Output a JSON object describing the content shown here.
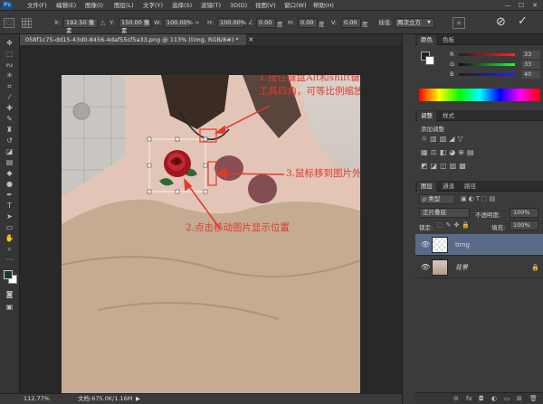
{
  "menubar": {
    "items": [
      "文件(F)",
      "编辑(E)",
      "图像(I)",
      "图层(L)",
      "文字(Y)",
      "选择(S)",
      "滤镜(T)",
      "3D(D)",
      "视图(V)",
      "窗口(W)",
      "帮助(H)"
    ],
    "minimize": "—",
    "restore": "☐",
    "close": "✕"
  },
  "options": {
    "x_label": "X:",
    "x_value": "192.50 像素",
    "y_label": "Y:",
    "y_value": "150.00 像素",
    "w_label": "W:",
    "w_value": "100.00%",
    "h_label": "H:",
    "h_value": "100.00%",
    "angle_value": "0.00",
    "hskew_label": "H:",
    "hskew_value": "0.00",
    "vskew_label": "V:",
    "vskew_value": "0.00",
    "interp_label": "插值:",
    "interp_value": "两次立方",
    "cancel": "⊘",
    "commit": "✓"
  },
  "document": {
    "tab_title": "058f1c75-dd15-43d0-8456-4daf55cf5a33.png @ 113% (timg, RGB/8#) *",
    "tab_close": "×"
  },
  "annotations": {
    "a1_line1": "1.按住键盘Alt和shift键，鼠标移动变形",
    "a1_line2": "工具四角，可等比例缩放图片",
    "a2": "2.点击移动图片显示位置",
    "a3": "3.鼠标移到图片外面可旋转图片"
  },
  "status": {
    "zoom": "112.77%",
    "doc_info": "文档:675.0K/1.16M",
    "arrow": "▶"
  },
  "color_panel": {
    "tabs": [
      "颜色",
      "色板"
    ],
    "rows": [
      {
        "label": "R",
        "value": "33"
      },
      {
        "label": "G",
        "value": "33"
      },
      {
        "label": "B",
        "value": "40"
      }
    ]
  },
  "adjust_panel": {
    "tabs": [
      "调整",
      "样式"
    ],
    "add_label": "添加调整"
  },
  "layers_panel": {
    "tabs": [
      "图层",
      "通道",
      "路径"
    ],
    "filter_label": "ρ 类型",
    "blend_mode": "正片叠底",
    "opacity_label": "不透明度:",
    "opacity_value": "100%",
    "lock_label": "锁定:",
    "fill_label": "填充:",
    "fill_value": "100%",
    "layers": [
      {
        "name": "timg",
        "selected": true
      },
      {
        "name": "背景",
        "selected": false
      }
    ],
    "footer_icons": [
      "link-icon",
      "fx-icon",
      "mask-icon",
      "adjust-icon",
      "folder-icon",
      "new-layer-icon",
      "trash-icon"
    ],
    "footer_glyphs": [
      "⊖",
      "fx",
      "◘",
      "◐",
      "▭",
      "⊞",
      "🗑"
    ]
  },
  "colors": {
    "accent_red": "#e23a2a",
    "selected_layer": "#5a6b8a"
  }
}
